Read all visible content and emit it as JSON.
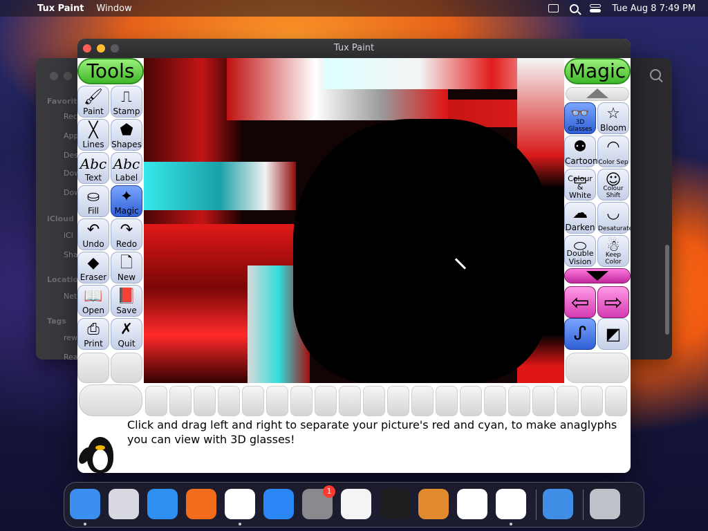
{
  "menubar": {
    "app_name": "Tux Paint",
    "menu_window": "Window",
    "datetime": "Tue Aug 8  7:49 PM"
  },
  "background_window": {
    "sidebar": [
      "Favorites",
      "Rec",
      "App",
      "Des",
      "Dow",
      "Dow",
      "iCloud",
      "iCl",
      "Sha",
      "Location",
      "Net",
      "Tags",
      "rew",
      "Rea"
    ]
  },
  "window": {
    "title": "Tux Paint"
  },
  "tools": {
    "header": "Tools",
    "items": [
      {
        "label": "Paint",
        "icon": "brush-icon",
        "glyph": "🖌"
      },
      {
        "label": "Stamp",
        "icon": "stamp-icon",
        "glyph": "⎍"
      },
      {
        "label": "Lines",
        "icon": "lines-icon",
        "glyph": "╳"
      },
      {
        "label": "Shapes",
        "icon": "pentagon-icon",
        "glyph": "⬟"
      },
      {
        "label": "Text",
        "icon": "text-icon",
        "glyph": "Abc"
      },
      {
        "label": "Label",
        "icon": "label-icon",
        "glyph": "Abc"
      },
      {
        "label": "Fill",
        "icon": "bucket-icon",
        "glyph": "⛀"
      },
      {
        "label": "Magic",
        "icon": "magic-wand-icon",
        "glyph": "✦"
      },
      {
        "label": "Undo",
        "icon": "undo-icon",
        "glyph": "↶"
      },
      {
        "label": "Redo",
        "icon": "redo-icon",
        "glyph": "↷"
      },
      {
        "label": "Eraser",
        "icon": "eraser-icon",
        "glyph": "◆"
      },
      {
        "label": "New",
        "icon": "new-page-icon",
        "glyph": "🗋"
      },
      {
        "label": "Open",
        "icon": "open-book-icon",
        "glyph": "📖"
      },
      {
        "label": "Save",
        "icon": "save-book-icon",
        "glyph": "📕"
      },
      {
        "label": "Print",
        "icon": "printer-icon",
        "glyph": "⎙"
      },
      {
        "label": "Quit",
        "icon": "quit-icon",
        "glyph": "✗"
      }
    ]
  },
  "magic": {
    "header": "Magic",
    "items": [
      {
        "label": "3D Glasses",
        "icon": "3d-glasses-icon",
        "glyph": "👓",
        "small": true
      },
      {
        "label": "Bloom",
        "icon": "star-icon",
        "glyph": "☆",
        "small": false
      },
      {
        "label": "Cartoon",
        "icon": "cartoon-icon",
        "glyph": "⚉",
        "small": false
      },
      {
        "label": "Color Sep",
        "icon": "color-sep-icon",
        "glyph": "◠",
        "small": true
      },
      {
        "label": "Colour & White",
        "icon": "colour-white-icon",
        "glyph": "▭",
        "small": false
      },
      {
        "label": "Colour Shift",
        "icon": "colour-shift-icon",
        "glyph": "☺",
        "small": true
      },
      {
        "label": "Darken",
        "icon": "darken-icon",
        "glyph": "☁",
        "small": false
      },
      {
        "label": "Desaturate",
        "icon": "desaturate-icon",
        "glyph": "◡",
        "small": true
      },
      {
        "label": "Double Vision",
        "icon": "double-vision-icon",
        "glyph": "⬭",
        "small": false
      },
      {
        "label": "Keep Color",
        "icon": "keep-color-icon",
        "glyph": "☃",
        "small": true
      }
    ]
  },
  "instruction": "Click and drag left and right to separate your picture's red and cyan, to make anaglyphs you can view with 3D glasses!",
  "dock": {
    "apps": [
      {
        "name": "finder-icon",
        "color": "#3a8ff0",
        "running": true
      },
      {
        "name": "launchpad-icon",
        "color": "#d8d8e0",
        "running": false
      },
      {
        "name": "safari-icon",
        "color": "#2f8ff0",
        "running": false
      },
      {
        "name": "firefox-icon",
        "color": "#f36b1c",
        "running": false
      },
      {
        "name": "chrome-icon",
        "color": "#ffffff",
        "running": true
      },
      {
        "name": "app-store-icon",
        "color": "#2a86f5",
        "running": false
      },
      {
        "name": "system-settings-icon",
        "color": "#8a8a8e",
        "running": false,
        "badge": "1"
      },
      {
        "name": "textedit-icon",
        "color": "#f4f4f4",
        "running": false
      },
      {
        "name": "terminal-icon",
        "color": "#1e1e1e",
        "running": false
      },
      {
        "name": "garageband-icon",
        "color": "#e28a2e",
        "running": false
      },
      {
        "name": "vscode-icon",
        "color": "#ffffff",
        "running": false
      },
      {
        "name": "tux-paint-icon",
        "color": "#ffffff",
        "running": true
      },
      {
        "name": "weather-icon",
        "color": "#3f8ee6",
        "running": false
      },
      {
        "name": "trash-icon",
        "color": "#bfc2c8",
        "running": false
      }
    ]
  }
}
